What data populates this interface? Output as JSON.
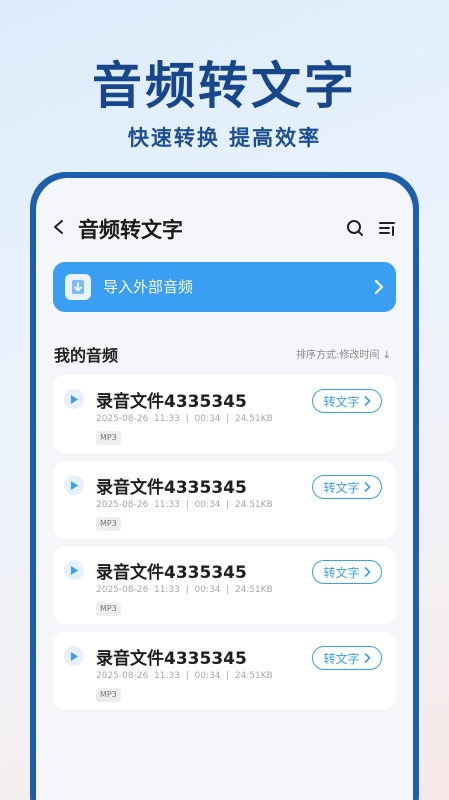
{
  "promo": {
    "title": "音频转文字",
    "subtitle": "快速转换 提高效率"
  },
  "header": {
    "title": "音频转文字"
  },
  "import": {
    "label": "导入外部音频"
  },
  "list": {
    "title": "我的音频",
    "sort_label": "排序方式:修改时间 ↓",
    "convert_label": "转文字",
    "items": [
      {
        "name": "录音文件4335345",
        "date": "2025-08-26",
        "time": "11:33",
        "duration": "00:34",
        "size": "24.51KB",
        "format": "MP3"
      },
      {
        "name": "录音文件4335345",
        "date": "2025-08-26",
        "time": "11:33",
        "duration": "00:34",
        "size": "24.51KB",
        "format": "MP3"
      },
      {
        "name": "录音文件4335345",
        "date": "2025-08-26",
        "time": "11:33",
        "duration": "00:34",
        "size": "24.51KB",
        "format": "MP3"
      },
      {
        "name": "录音文件4335345",
        "date": "2025-08-26",
        "time": "11:33",
        "duration": "00:34",
        "size": "24.51KB",
        "format": "MP3"
      }
    ]
  },
  "icons": {
    "back": "chevron-left-icon",
    "search": "search-icon",
    "list": "list-sort-icon",
    "import": "download-icon",
    "play": "play-icon"
  },
  "colors": {
    "accent": "#3a9ef3",
    "brand_dark": "#17468a",
    "phone_frame": "#1e5fad"
  }
}
